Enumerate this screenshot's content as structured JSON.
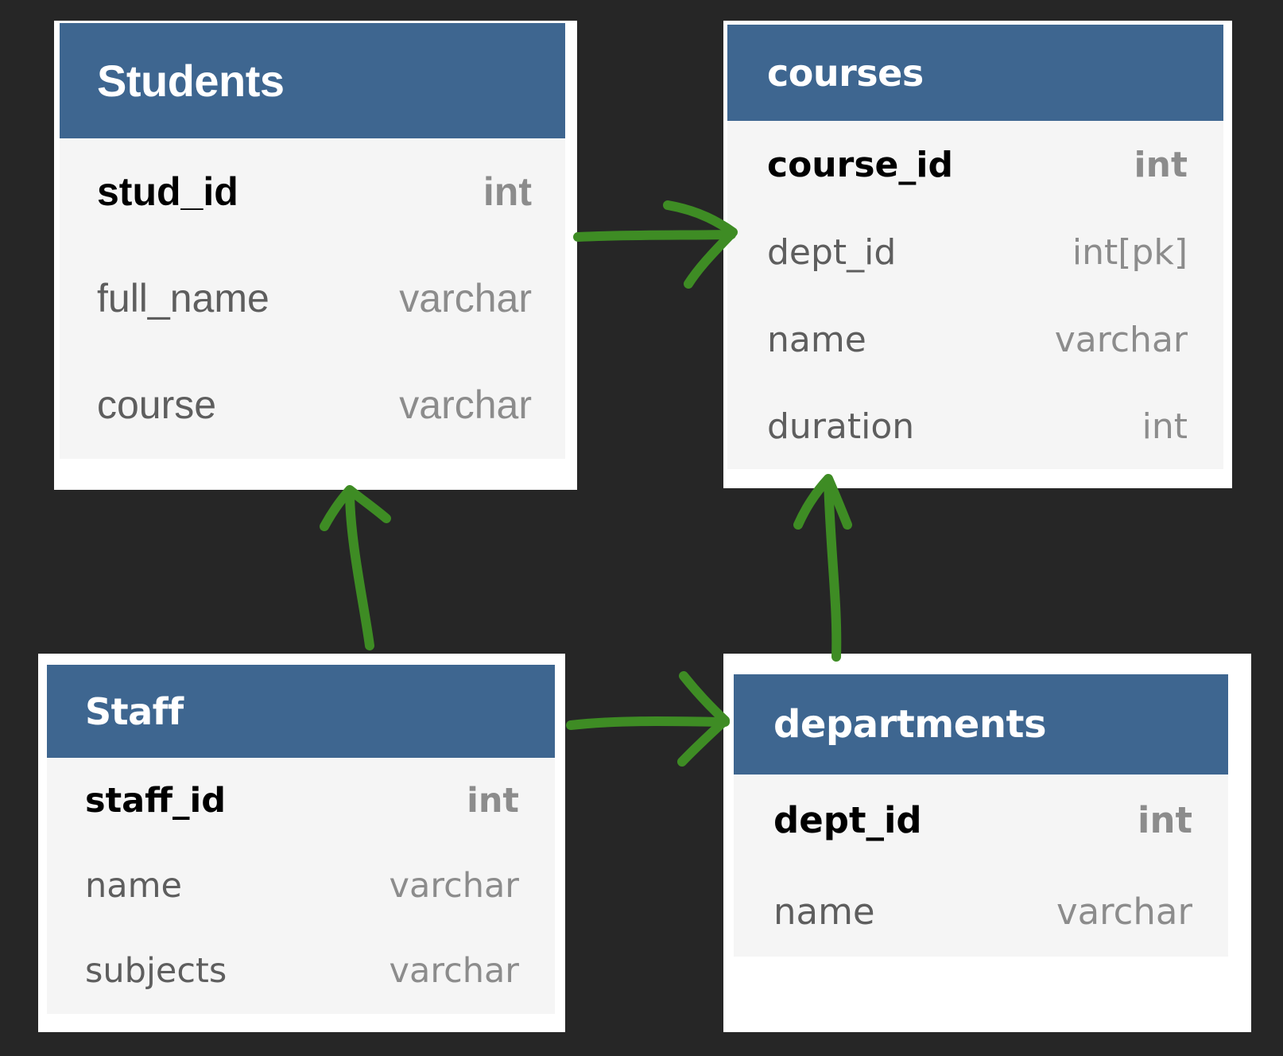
{
  "diagram": {
    "arrow_color": "#3e8c24",
    "header_color": "#3e6690",
    "tables": [
      {
        "title": "Students",
        "fields": [
          {
            "name": "stud_id",
            "type": "int",
            "primary": true
          },
          {
            "name": "full_name",
            "type": "varchar",
            "primary": false
          },
          {
            "name": "course",
            "type": "varchar",
            "primary": false
          }
        ]
      },
      {
        "title": "courses",
        "fields": [
          {
            "name": "course_id",
            "type": "int",
            "primary": true
          },
          {
            "name": "dept_id",
            "type": "int[pk]",
            "primary": false
          },
          {
            "name": "name",
            "type": "varchar",
            "primary": false
          },
          {
            "name": "duration",
            "type": "int",
            "primary": false
          }
        ]
      },
      {
        "title": "Staff",
        "fields": [
          {
            "name": "staff_id",
            "type": "int",
            "primary": true
          },
          {
            "name": "name",
            "type": "varchar",
            "primary": false
          },
          {
            "name": "subjects",
            "type": "varchar",
            "primary": false
          }
        ]
      },
      {
        "title": "departments",
        "fields": [
          {
            "name": "dept_id",
            "type": "int",
            "primary": true
          },
          {
            "name": "name",
            "type": "varchar",
            "primary": false
          }
        ]
      }
    ],
    "relationships": [
      {
        "from": "Students",
        "to": "courses"
      },
      {
        "from": "Staff",
        "to": "Students"
      },
      {
        "from": "Staff",
        "to": "departments"
      },
      {
        "from": "departments",
        "to": "courses"
      }
    ]
  }
}
